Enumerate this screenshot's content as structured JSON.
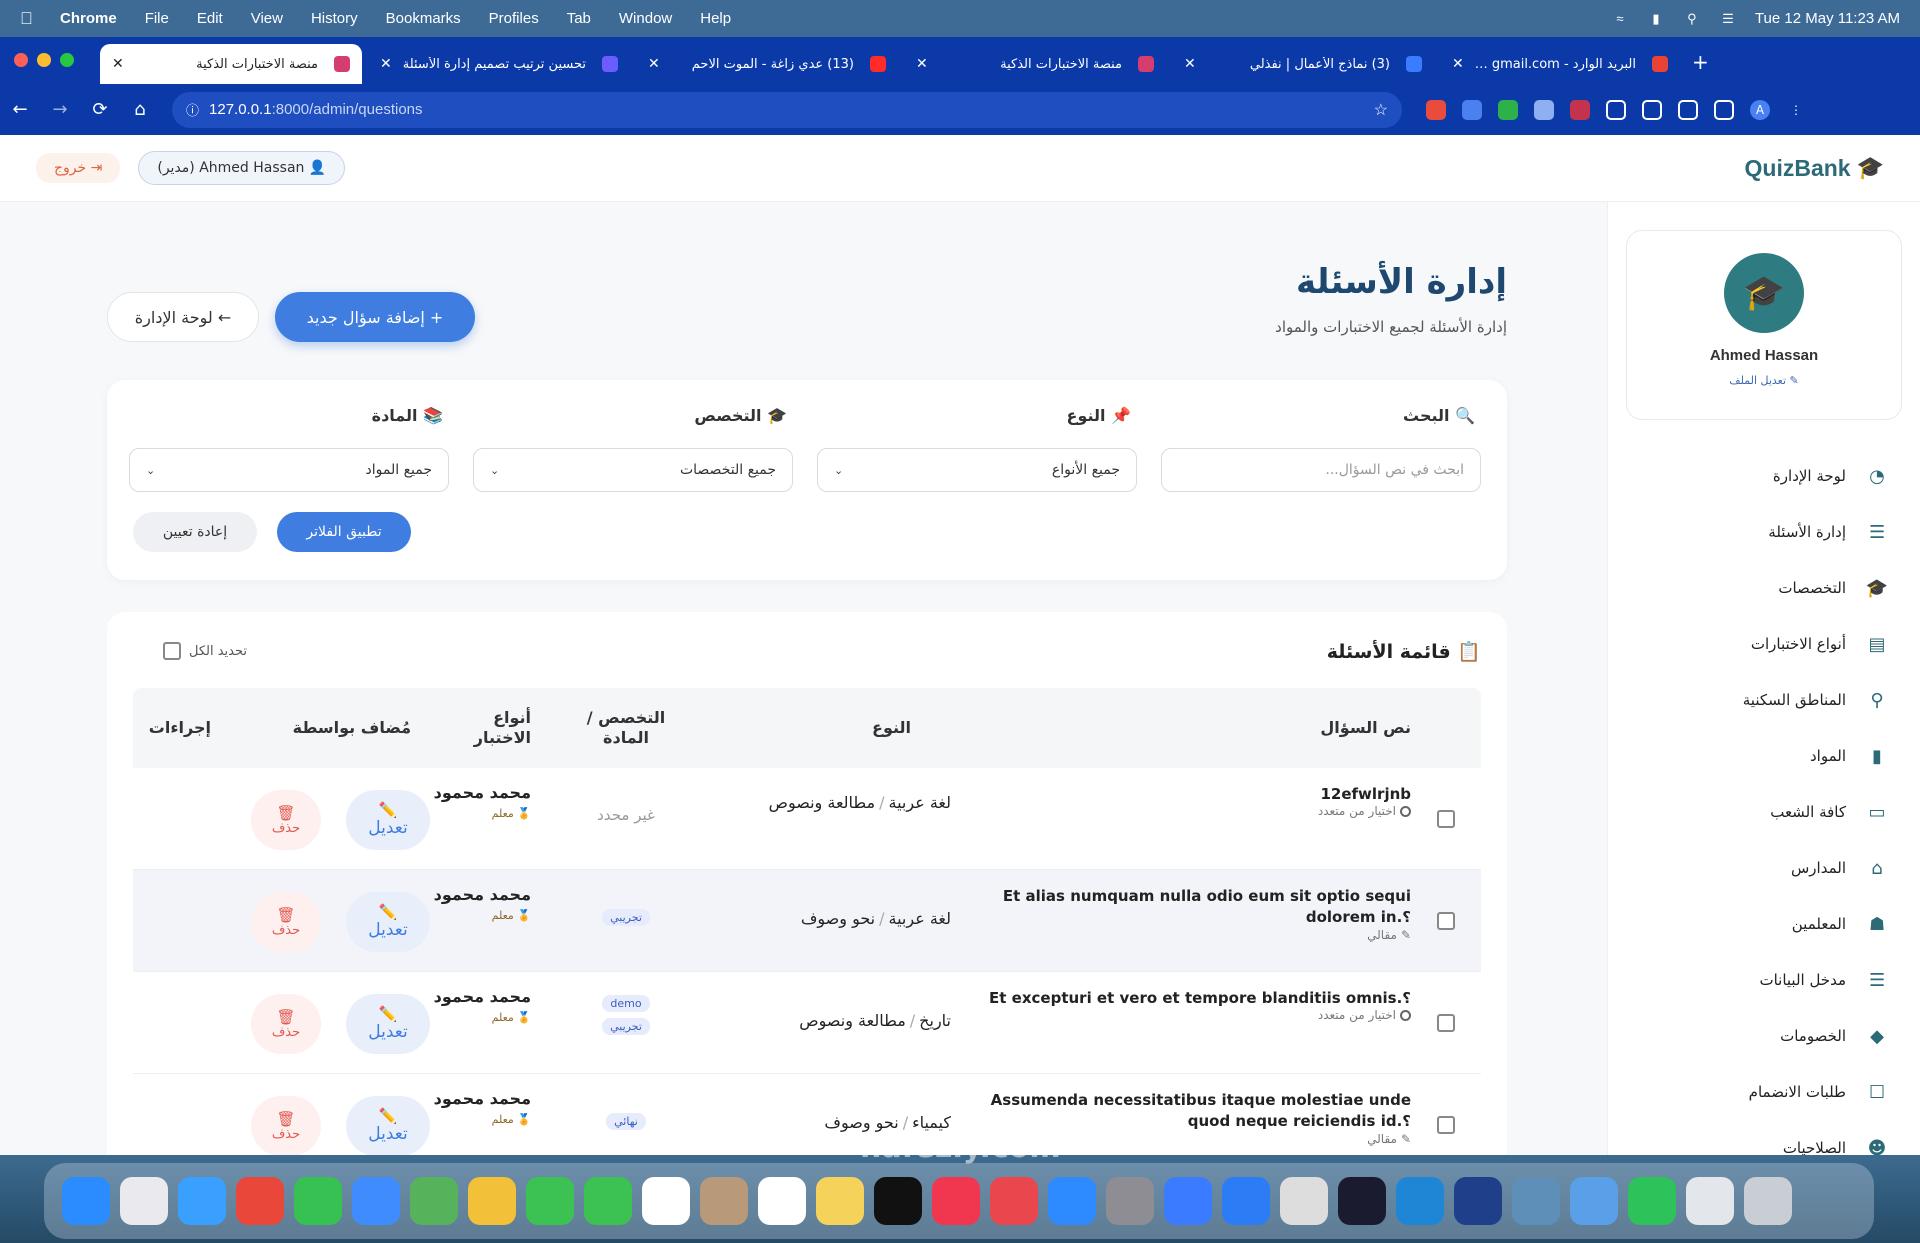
{
  "menubar": {
    "app": "Chrome",
    "items": [
      "File",
      "Edit",
      "View",
      "History",
      "Bookmarks",
      "Profiles",
      "Tab",
      "Window",
      "Help"
    ],
    "datetime": "Tue 12 May  11:23 AM"
  },
  "tabs": [
    {
      "title": "منصة الاختبارات الذكية",
      "active": true
    },
    {
      "title": "تحسين ترتيب تصميم إدارة الأسئلة"
    },
    {
      "title": "(13) عدي زاغة - الموت الاحم"
    },
    {
      "title": "منصة الاختبارات الذكية"
    },
    {
      "title": "(3) نماذج الأعمال | نفذلي"
    },
    {
      "title": "البريد الوارد - Gmail ‪gmail.com‬"
    }
  ],
  "url": {
    "host": "127.0.0.1",
    "path": ":8000/admin/questions"
  },
  "topbar": {
    "brand": "QuizBank",
    "user": "Ahmed Hassan (مدير)",
    "logout": "خروج"
  },
  "sidebar": {
    "name": "Ahmed Hassan",
    "edit_profile": "تعديل الملف",
    "items": [
      {
        "label": "لوحة الإدارة",
        "icon": "dashboard-icon"
      },
      {
        "label": "إدارة الأسئلة",
        "icon": "database-icon"
      },
      {
        "label": "التخصصات",
        "icon": "graduation-cap-icon"
      },
      {
        "label": "أنواع الاختبارات",
        "icon": "list-icon"
      },
      {
        "label": "المناطق السكنية",
        "icon": "map-pin-icon"
      },
      {
        "label": "المواد",
        "icon": "book-icon"
      },
      {
        "label": "كافة الشعب",
        "icon": "laptop-icon"
      },
      {
        "label": "المدارس",
        "icon": "school-icon"
      },
      {
        "label": "المعلمين",
        "icon": "teacher-icon"
      },
      {
        "label": "مدخل البيانات",
        "icon": "database-icon"
      },
      {
        "label": "الخصومات",
        "icon": "tag-icon"
      },
      {
        "label": "طلبات الانضمام",
        "icon": "request-icon"
      },
      {
        "label": "الصلاحيات",
        "icon": "user-shield-icon"
      }
    ]
  },
  "header": {
    "title": "إدارة الأسئلة",
    "subtitle": "إدارة الأسئلة لجميع الاختبارات والمواد",
    "add_button": "+ إضافة سؤال جديد",
    "back_button": "← لوحة الإدارة"
  },
  "filters": {
    "search_label": "🔍 البحث",
    "search_placeholder": "ابحث في نص السؤال...",
    "type_label": "📌 النوع",
    "type_value": "جميع الأنواع",
    "spec_label": "🎓 التخصص",
    "spec_value": "جميع التخصصات",
    "subject_label": "📚 المادة",
    "subject_value": "جميع المواد",
    "apply": "تطبيق الفلاتر",
    "reset": "إعادة تعيين"
  },
  "list": {
    "title": "📋 قائمة الأسئلة",
    "select_all": "تحديد الكل",
    "columns": {
      "question": "نص السؤال",
      "type": "النوع",
      "spec": "التخصص / المادة",
      "test_types": "أنواع الاختبار",
      "added_by": "مُضاف بواسطة",
      "actions": "إجراءات"
    },
    "edit_label": "تعديل",
    "delete_label": "حذف",
    "rows": [
      {
        "text": "12efwlrjnb",
        "kind": "اختيار من متعدد",
        "subject": "لغة عربية",
        "topic": "مطالعة ونصوص",
        "spec": "غير محدد",
        "badges": [],
        "adder": "محمد محمود",
        "role": "معلم"
      },
      {
        "text": "Et alias numquam nulla odio eum sit optio sequi dolorem in.؟",
        "kind": "مقالي",
        "subject": "لغة عربية",
        "topic": "نحو وصوف",
        "spec": "",
        "badges": [
          "تجريبي"
        ],
        "adder": "محمد محمود",
        "role": "معلم"
      },
      {
        "text": "Et excepturi et vero et tempore blanditiis omnis.؟",
        "kind": "اختيار من متعدد",
        "subject": "تاريخ",
        "topic": "مطالعة ونصوص",
        "spec": "",
        "badges": [
          "demo",
          "تجريبي"
        ],
        "adder": "محمد محمود",
        "role": "معلم"
      },
      {
        "text": "Assumenda necessitatibus itaque molestiae unde quod neque reiciendis id.؟",
        "kind": "مقالي",
        "subject": "كيمياء",
        "topic": "نحو وصوف",
        "spec": "",
        "badges": [
          "نهائي"
        ],
        "adder": "محمد محمود",
        "role": "معلم"
      }
    ]
  },
  "watermark": "nafezly.com"
}
